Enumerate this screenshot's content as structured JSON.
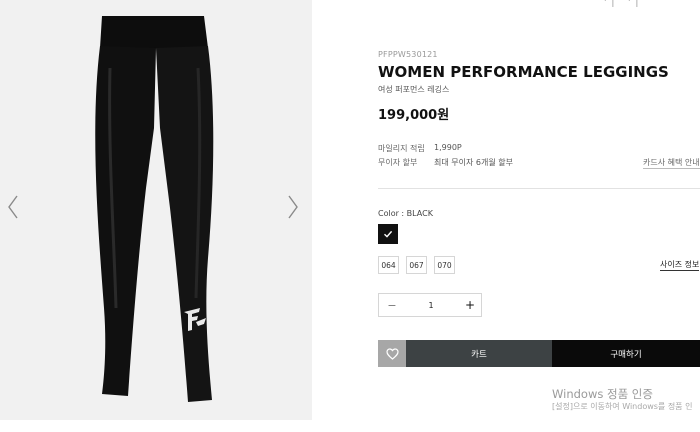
{
  "gallery": {
    "prev_icon": "chevron-left-icon",
    "next_icon": "chevron-right-icon"
  },
  "top_fragments": [
    "' |",
    "' |"
  ],
  "product": {
    "sku": "PFPPW530121",
    "title": "WOMEN PERFORMANCE LEGGINGS",
    "subtitle": "여성 퍼포먼스 레깅스",
    "price": "199,000원"
  },
  "benefits": {
    "mileage_label": "마일리지 적립",
    "mileage_value": "1,990P",
    "installment_label": "무이자 할부",
    "installment_value": "최대 무이자 6개월 할부",
    "card_link": "카드사 혜택 안내"
  },
  "options": {
    "color_label": "Color : BLACK",
    "selected_color": "#111111",
    "sizes": [
      "064",
      "067",
      "070"
    ],
    "size_guide": "사이즈 정보"
  },
  "quantity": {
    "minus": "−",
    "value": "1",
    "plus": "+"
  },
  "actions": {
    "wish_icon": "heart-icon",
    "cart": "카트",
    "buy": "구매하기"
  },
  "watermark": {
    "title": "Windows 정품 인증",
    "subtitle": "[설정]으로 이동하여 Windows를 정품 인"
  },
  "colors": {
    "cart_bg": "#3d4244",
    "buy_bg": "#0a0a0a",
    "wish_bg": "#a7a7a7",
    "gallery_bg": "#f1f1f1"
  }
}
